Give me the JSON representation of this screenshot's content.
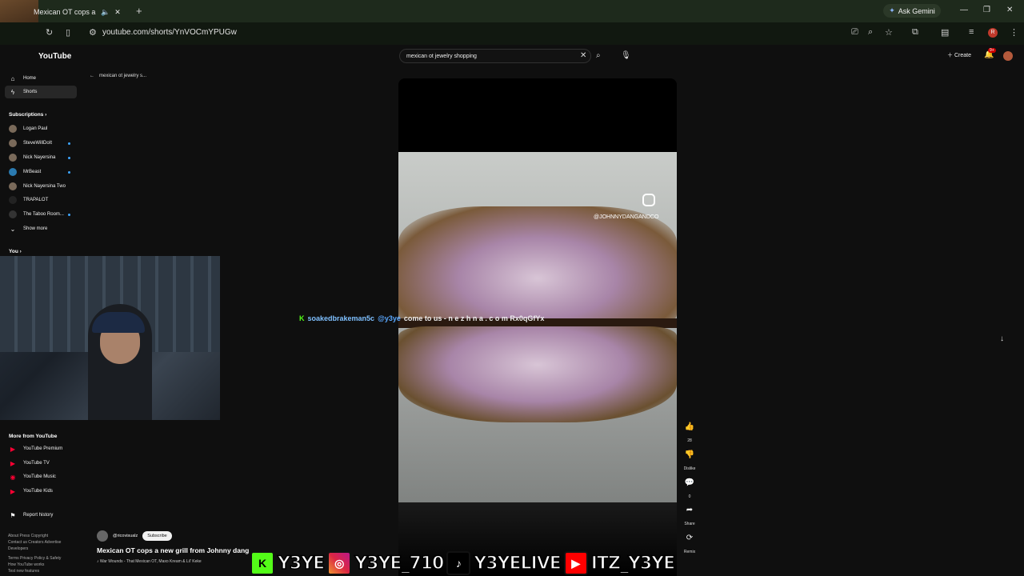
{
  "browser": {
    "tab_title": "Mexican OT cops a new",
    "new_tab_label": "+",
    "ask_gemini": "Ask Gemini",
    "url": "youtube.com/shorts/YnVOCmYPUGw"
  },
  "youtube": {
    "logo": "YouTube",
    "search_value": "mexican ot jewelry shopping",
    "create_label": "Create",
    "notif_badge": "9+",
    "back_label": "mexican ot jewelry s..."
  },
  "sidebar": {
    "home": "Home",
    "shorts": "Shorts",
    "subscriptions_title": "Subscriptions",
    "subscriptions": [
      "Logan Paul",
      "SteveWillDoIt",
      "Nick Nayersina",
      "MrBeast",
      "Nick Nayersina Two",
      "TRAPALOT",
      "The Taboo Room..."
    ],
    "show_more": "Show more",
    "you_title": "You",
    "more_title": "More from YouTube",
    "more_items": [
      "YouTube Premium",
      "YouTube TV",
      "YouTube Music",
      "YouTube Kids"
    ],
    "report_history": "Report history",
    "footer": [
      "About  Press  Copyright",
      "Contact us  Creators  Advertise",
      "Developers",
      "Terms  Privacy  Policy & Safety",
      "How YouTube works",
      "Test new features"
    ]
  },
  "video": {
    "ig_handle": "@JOHNNYDANGANDCO",
    "channel": "@ricovisualz",
    "subscribe": "Subscribe",
    "title": "Mexican OT cops a new grill from Johnny dang",
    "music": "♪ War Wounds - That Mexican OT, Maxo Kream & Lil' Keke",
    "likes": "28",
    "dislike": "Dislike",
    "comments": "0",
    "share": "Share",
    "remix": "Remix"
  },
  "chat": {
    "user": "soakedbrakeman5c",
    "mention": "@y3ye",
    "message": "come to us - n e z h n a . c o m Rx0qGfYx"
  },
  "socials": {
    "kick": "Y3YE",
    "instagram": "Y3YE_710",
    "tiktok": "Y3YELIVE",
    "youtube": "ITZ_Y3YE"
  }
}
